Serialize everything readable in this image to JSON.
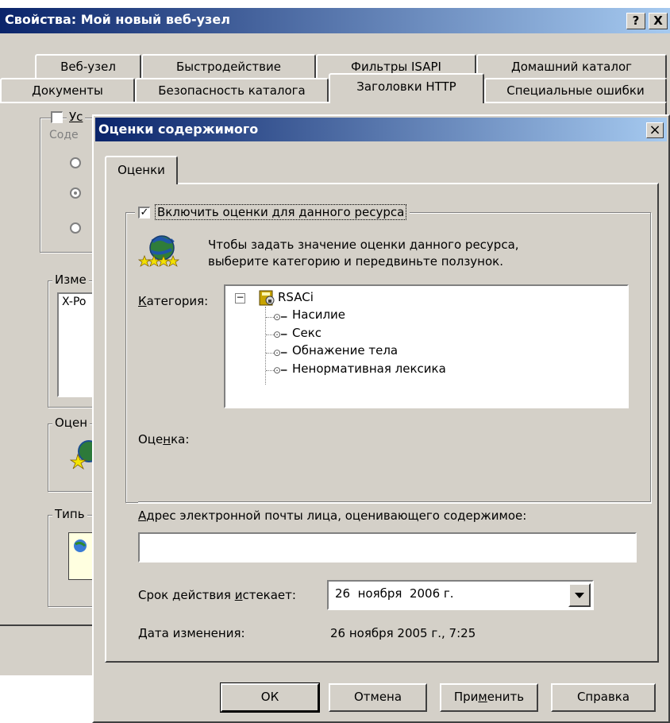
{
  "outer_window": {
    "title": "Свойства: Мой новый веб-узел",
    "help_button": "?",
    "close_button": "X",
    "tabs_row1": [
      "Веб-узел",
      "Быстродействие",
      "Фильтры ISAPI",
      "Домашний каталог"
    ],
    "tabs_row2": [
      "Документы",
      "Безопасность каталога",
      "Заголовки HTTP",
      "Специальные ошибки"
    ],
    "active_tab": "Заголовки HTTP",
    "partial_labels": [
      "Ус",
      "Соде",
      "Изме",
      "X-Po",
      "Оцен",
      "Типь"
    ]
  },
  "ratings_dialog": {
    "title": "Оценки содержимого",
    "close_button": "×",
    "tab": "Оценки",
    "enable_label": "Включить оценки для данного ресурса",
    "enable_checked": true,
    "info_line1": "Чтобы задать значение оценки данного ресурса,",
    "info_line2": "выберите категорию и передвиньте ползунок.",
    "category_label": "Категория:",
    "tree": {
      "expand_symbol": "⊟",
      "root": "RSACi",
      "children": [
        "Насилие",
        "Секс",
        "Обнажение тела",
        "Ненормативная лексика"
      ]
    },
    "rating_label": "Оценка:",
    "email_label": "Адрес электронной почты лица, оценивающего содержимое:",
    "email_value": "",
    "expires_label": "Срок действия истекает:",
    "expires_value": "26  ноября  2006 г.",
    "modified_label": "Дата изменения:",
    "modified_value": "26 ноября 2005 г., 7:25",
    "buttons": {
      "ok": "ОК",
      "cancel": "Отмена",
      "apply": "Применить",
      "help": "Справка"
    }
  },
  "colors": {
    "title_start": "#0a246a",
    "title_end": "#a6caf0",
    "face": "#d4d0c8",
    "red_marker": "#e0001a"
  }
}
